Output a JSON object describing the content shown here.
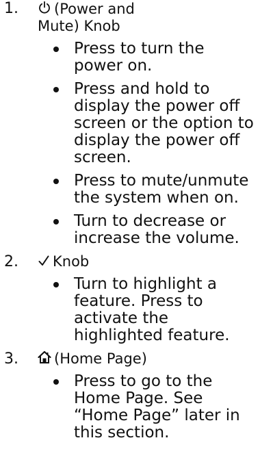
{
  "items": [
    {
      "number": "1.",
      "icon": "power-icon",
      "icon_glyph": "⏻",
      "heading_line1": "(Power and",
      "heading_line2": "Mute) Knob",
      "bullets": [
        "Press to turn the power on.",
        "Press and hold to display the power off screen or the option to display the power off screen.",
        "Press to mute/unmute the system when on.",
        "Turn to decrease or increase the volume."
      ]
    },
    {
      "number": "2.",
      "icon": "checkmark-icon",
      "icon_glyph": "✓",
      "heading_line1": "Knob",
      "bullets": [
        "Turn to highlight a feature. Press to activate the highlighted feature."
      ]
    },
    {
      "number": "3.",
      "icon": "home-icon",
      "icon_glyph": "⌂",
      "heading_line1": "(Home Page)",
      "bullets": [
        "Press to go to the Home Page. See “Home Page” later in this section."
      ]
    }
  ]
}
